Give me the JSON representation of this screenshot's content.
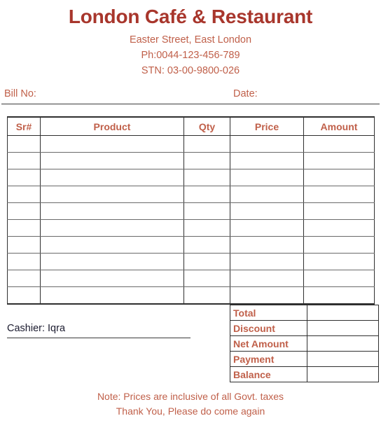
{
  "header": {
    "title": "London Café & Restaurant",
    "address": "Easter Street, East London",
    "phone": "Ph:0044-123-456-789",
    "stn": "STN: 03-00-9800-026"
  },
  "bill_meta": {
    "bill_no_label": "Bill No:",
    "bill_no_value": "",
    "date_label": "Date:",
    "date_value": ""
  },
  "items_table": {
    "columns": [
      "Sr#",
      "Product",
      "Qty",
      "Price",
      "Amount"
    ],
    "rows": [
      [
        "",
        "",
        "",
        "",
        ""
      ],
      [
        "",
        "",
        "",
        "",
        ""
      ],
      [
        "",
        "",
        "",
        "",
        ""
      ],
      [
        "",
        "",
        "",
        "",
        ""
      ],
      [
        "",
        "",
        "",
        "",
        ""
      ],
      [
        "",
        "",
        "",
        "",
        ""
      ],
      [
        "",
        "",
        "",
        "",
        ""
      ],
      [
        "",
        "",
        "",
        "",
        ""
      ],
      [
        "",
        "",
        "",
        "",
        ""
      ],
      [
        "",
        "",
        "",
        "",
        ""
      ]
    ]
  },
  "cashier": {
    "text": "Cashier: Iqra"
  },
  "totals": {
    "rows": [
      {
        "label": "Total",
        "value": ""
      },
      {
        "label": "Discount",
        "value": ""
      },
      {
        "label": "Net Amount",
        "value": ""
      },
      {
        "label": "Payment",
        "value": ""
      },
      {
        "label": "Balance",
        "value": ""
      }
    ]
  },
  "footer": {
    "note": "Note: Prices are inclusive of all Govt. taxes",
    "thanks": "Thank You, Please do come again"
  },
  "colors": {
    "title_red": "#A8362C",
    "text_red": "#C0604A",
    "border_dark": "#2f2f2f",
    "border_light": "#6a6a6a",
    "cashier_text": "#1a1a2e"
  }
}
